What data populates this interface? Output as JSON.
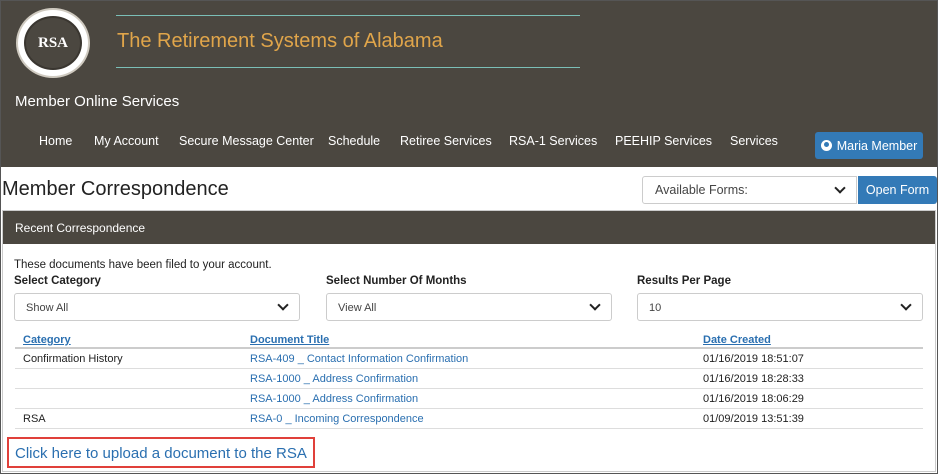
{
  "header": {
    "logo_text": "RSA",
    "logo_ring_text": "THE RETIREMENT SYSTEMS OF ALABAMA",
    "site_title": "The Retirement Systems of Alabama",
    "subtitle": "Member Online Services",
    "nav": [
      "Home",
      "My Account",
      "Secure Message Center",
      "Schedule",
      "Retiree Services",
      "RSA-1 Services",
      "PEEHIP Services",
      "Services"
    ],
    "user_button": "Maria Member"
  },
  "page": {
    "title": "Member Correspondence",
    "forms_select": "Available Forms:",
    "open_form_button": "Open Form"
  },
  "panel": {
    "heading": "Recent Correspondence",
    "intro": "These documents have been filed to your account.",
    "filters": [
      {
        "label": "Select Category",
        "value": "Show All"
      },
      {
        "label": "Select Number Of Months",
        "value": "View All"
      },
      {
        "label": "Results Per Page",
        "value": "10"
      }
    ],
    "table": {
      "columns": [
        "Category",
        "Document Title",
        "Date Created"
      ],
      "rows": [
        [
          "Confirmation History",
          "RSA-409 _ Contact Information Confirmation",
          "01/16/2019 18:51:07"
        ],
        [
          "",
          "RSA-1000 _ Address Confirmation",
          "01/16/2019 18:28:33"
        ],
        [
          "",
          "RSA-1000 _ Address Confirmation",
          "01/16/2019 18:06:29"
        ],
        [
          "RSA",
          "RSA-0 _ Incoming Correspondence",
          "01/09/2019 13:51:39"
        ]
      ]
    },
    "upload_link": "Click here to upload a document to the RSA"
  },
  "colors": {
    "header_bg": "#4b4740",
    "title_gold": "#e0a54a",
    "rule_teal": "#7bbfb7",
    "accent_blue": "#337ab7",
    "link_blue": "#2a6fb0",
    "highlight_red": "#e0403a"
  }
}
